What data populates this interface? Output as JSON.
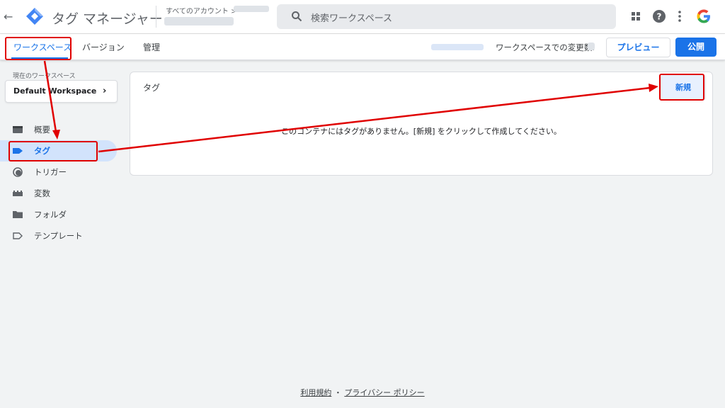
{
  "topbar": {
    "app_title": "タグ マネージャー",
    "account_label": "すべてのアカウント >",
    "search_placeholder": "検索ワークスペース"
  },
  "subbar": {
    "tabs": [
      {
        "label": "ワークスペース",
        "active": true
      },
      {
        "label": "バージョン"
      },
      {
        "label": "管理"
      }
    ],
    "changes_label": "ワークスペースでの変更数:",
    "preview_label": "プレビュー",
    "publish_label": "公開"
  },
  "sidebar": {
    "current_ws_label": "現在のワークスペース",
    "workspace_name": "Default Workspace",
    "items": [
      {
        "label": "概要",
        "icon": "overview-icon"
      },
      {
        "label": "タグ",
        "icon": "tag-icon",
        "active": true
      },
      {
        "label": "トリガー",
        "icon": "trigger-icon"
      },
      {
        "label": "変数",
        "icon": "variables-icon"
      },
      {
        "label": "フォルダ",
        "icon": "folder-icon"
      },
      {
        "label": "テンプレート",
        "icon": "template-icon"
      }
    ]
  },
  "main": {
    "card_title": "タグ",
    "new_button": "新規",
    "empty_message": "このコンテナにはタグがありません。[新規] をクリックして作成してください。"
  },
  "footer": {
    "terms": "利用規約",
    "separator": "・",
    "privacy": "プライバシー ポリシー"
  },
  "colors": {
    "accent": "#1a73e8",
    "annotation": "#e00000"
  }
}
